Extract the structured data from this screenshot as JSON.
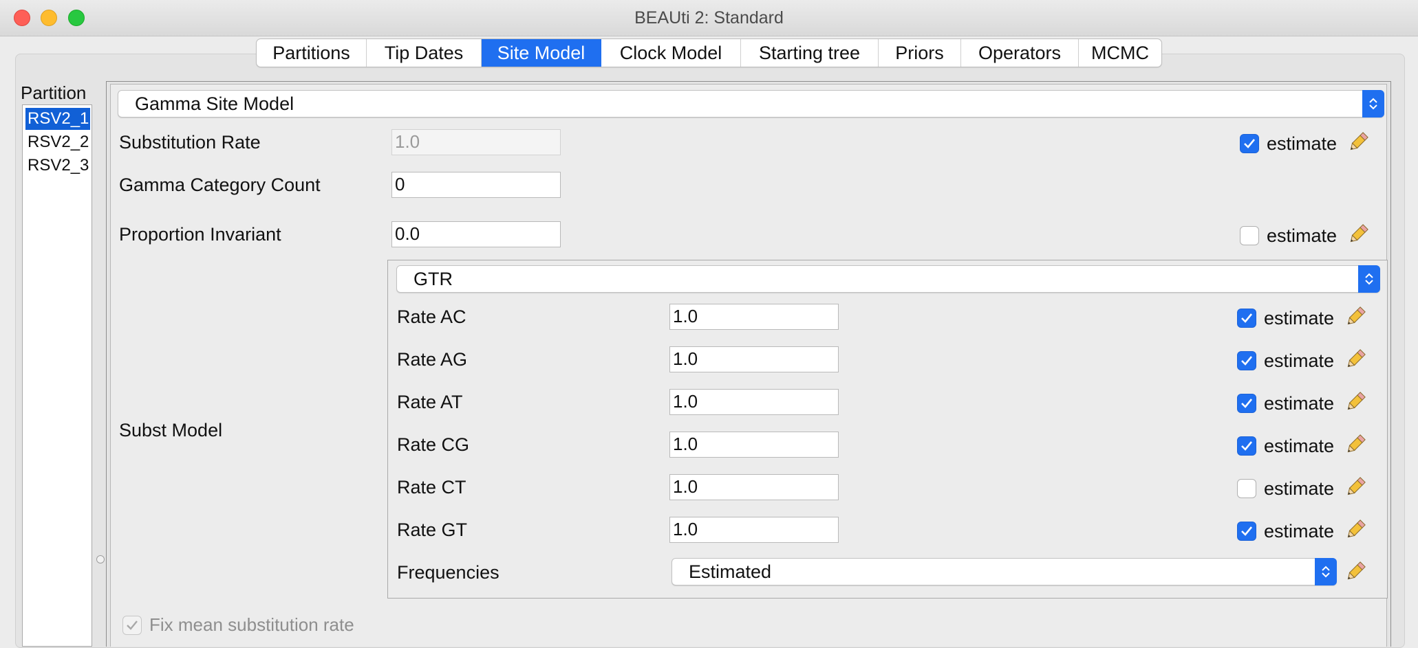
{
  "window": {
    "title": "BEAUti 2: Standard"
  },
  "tabs": [
    {
      "label": "Partitions",
      "active": false
    },
    {
      "label": "Tip Dates",
      "active": false
    },
    {
      "label": "Site Model",
      "active": true
    },
    {
      "label": "Clock Model",
      "active": false
    },
    {
      "label": "Starting tree",
      "active": false
    },
    {
      "label": "Priors",
      "active": false
    },
    {
      "label": "Operators",
      "active": false
    },
    {
      "label": "MCMC",
      "active": false
    }
  ],
  "partition_panel": {
    "header": "Partition",
    "items": [
      {
        "label": "RSV2_1",
        "selected": true
      },
      {
        "label": "RSV2_2",
        "selected": false
      },
      {
        "label": "RSV2_3",
        "selected": false
      }
    ]
  },
  "site_model": {
    "model_select": "Gamma Site Model",
    "substitution_rate": {
      "label": "Substitution Rate",
      "value": "1.0",
      "estimate": true,
      "estimate_label": "estimate"
    },
    "gamma_category_count": {
      "label": "Gamma Category Count",
      "value": "0"
    },
    "proportion_invariant": {
      "label": "Proportion Invariant",
      "value": "0.0",
      "estimate": false,
      "estimate_label": "estimate"
    },
    "subst_model": {
      "label": "Subst Model",
      "model_select": "GTR",
      "rates": [
        {
          "label": "Rate AC",
          "value": "1.0",
          "estimate": true,
          "estimate_label": "estimate"
        },
        {
          "label": "Rate AG",
          "value": "1.0",
          "estimate": true,
          "estimate_label": "estimate"
        },
        {
          "label": "Rate AT",
          "value": "1.0",
          "estimate": true,
          "estimate_label": "estimate"
        },
        {
          "label": "Rate CG",
          "value": "1.0",
          "estimate": true,
          "estimate_label": "estimate"
        },
        {
          "label": "Rate CT",
          "value": "1.0",
          "estimate": false,
          "estimate_label": "estimate"
        },
        {
          "label": "Rate GT",
          "value": "1.0",
          "estimate": true,
          "estimate_label": "estimate"
        }
      ],
      "frequencies": {
        "label": "Frequencies",
        "value": "Estimated"
      }
    },
    "fix_mean_substitution_rate": {
      "label": "Fix mean substitution rate",
      "checked": true,
      "enabled": false
    }
  },
  "colors": {
    "accent": "#1f6ff0",
    "selection": "#1160d6",
    "window_bg": "#ececec"
  }
}
